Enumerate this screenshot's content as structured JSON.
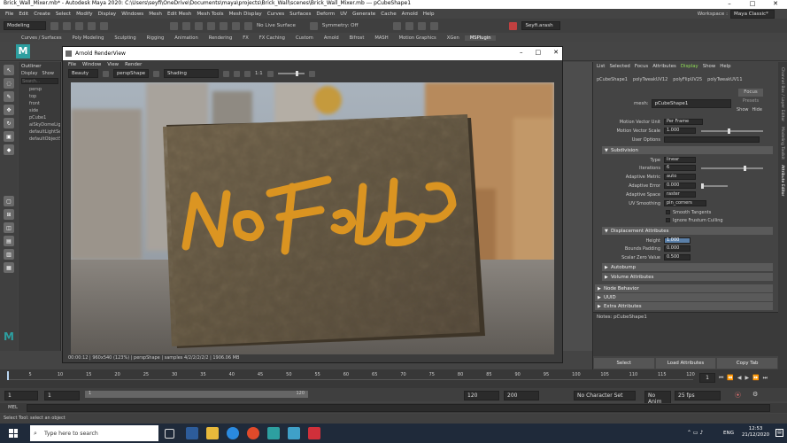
{
  "window_title": "Brick_Wall_Mixer.mb* - Autodesk Maya 2020: C:\\Users\\seyfi\\OneDrive\\Documents\\maya\\projects\\Brick_Wall\\scenes\\Brick_Wall_Mixer.mb --- pCubeShape1",
  "workspace_label": "Workspace :",
  "workspace_value": "Maya Classic*",
  "menus": [
    "File",
    "Edit",
    "Create",
    "Select",
    "Modify",
    "Display",
    "Windows",
    "Mesh",
    "Edit Mesh",
    "Mesh Tools",
    "Mesh Display",
    "Curves",
    "Surfaces",
    "Deform",
    "UV",
    "Generate",
    "Cache",
    "Arnold",
    "Help"
  ],
  "status": {
    "mode": "Modeling",
    "live_surface": "No Live Surface",
    "symmetry": "Symmetry: Off",
    "user": "Seyfi.arash"
  },
  "shelf_tabs": [
    "Curves / Surfaces",
    "Poly Modeling",
    "Sculpting",
    "Rigging",
    "Animation",
    "Rendering",
    "FX",
    "FX Caching",
    "Custom",
    "Arnold",
    "Bifrost",
    "MASH",
    "Motion Graphics",
    "XGen",
    "MSPlugin"
  ],
  "shelf_active": "MSPlugin",
  "outliner": {
    "title": "Outliner",
    "menu": [
      "Display",
      "Show"
    ],
    "search_placeholder": "Search...",
    "items": [
      "persp",
      "top",
      "front",
      "side",
      "pCube1",
      "aiSkyDomeLight1",
      "defaultLightSet",
      "defaultObjectSet"
    ]
  },
  "renderview": {
    "title": "Arnold RenderView",
    "menu": [
      "File",
      "Window",
      "View",
      "Render"
    ],
    "camera_dd": "Beauty",
    "view_dd": "perspShape",
    "shading_dd": "Shading",
    "ratio": "1:1",
    "status": "00:00:12 | 960x540 (123%) | perspShape | samples 4/2/2/2/2/2 | 1906.06 MB",
    "graffiti": "No Focus"
  },
  "viewport_label": "persp",
  "attr": {
    "menu": [
      "List",
      "Selected",
      "Focus",
      "Attributes",
      "Display",
      "Show",
      "Help"
    ],
    "tabs": [
      "pCubeShape1",
      "polyTweakUV12",
      "polyFlipUV25",
      "polyTweakUV11"
    ],
    "mesh_label": "mesh:",
    "mesh_value": "pCubeShape1",
    "focus_btn": "Focus",
    "presets_btn": "Presets",
    "show_btn": "Show",
    "hide_btn": "Hide",
    "rows": [
      {
        "label": "Motion Vector Unit",
        "value": "Per Frame"
      },
      {
        "label": "Motion Vector Scale",
        "value": "1.000"
      },
      {
        "label": "User Options",
        "value": ""
      }
    ],
    "subdiv_title": "Subdivision",
    "subdiv_rows": [
      {
        "label": "Type",
        "value": "linear"
      },
      {
        "label": "Iterations",
        "value": "6"
      },
      {
        "label": "Adaptive Metric",
        "value": "auto"
      },
      {
        "label": "Adaptive Error",
        "value": "0.000"
      },
      {
        "label": "Adaptive Space",
        "value": "raster"
      },
      {
        "label": "UV Smoothing",
        "value": "pin_corners"
      }
    ],
    "smooth_tangents": "Smooth Tangents",
    "ignore_frustum": "Ignore Frustum Culling",
    "disp_title": "Displacement Attributes",
    "disp_rows": [
      {
        "label": "Height",
        "value": "1.000"
      },
      {
        "label": "Bounds Padding",
        "value": "0.000"
      },
      {
        "label": "Scalar Zero Value",
        "value": "0.500"
      }
    ],
    "sections": [
      "Autobump",
      "Volume Attributes",
      "Node Behavior",
      "UUID",
      "Extra Attributes"
    ],
    "notes": "Notes: pCubeShape1",
    "buttons": [
      "Select",
      "Load Attributes",
      "Copy Tab"
    ]
  },
  "side_tabs": [
    "Channel Box / Layer Editor",
    "Modeling Toolkit",
    "Attribute Editor"
  ],
  "timeline": {
    "ticks": [
      "5",
      "10",
      "15",
      "20",
      "25",
      "30",
      "35",
      "40",
      "45",
      "50",
      "55",
      "60",
      "65",
      "70",
      "75",
      "80",
      "85",
      "90",
      "95",
      "100",
      "105",
      "110",
      "115",
      "120"
    ],
    "current": "1"
  },
  "range": {
    "start": "1",
    "start2": "1",
    "slider_start": "1",
    "slider_end": "120",
    "end": "120",
    "end2": "200",
    "character_set": "No Character Set",
    "anim_layer": "No Anim Layer",
    "fps": "25 fps"
  },
  "cmd_label": "MEL",
  "help_line": "Select Tool: select an object",
  "taskbar": {
    "search_placeholder": "Type here to search",
    "lang": "ENG",
    "time": "12:53",
    "date": "21/12/2020"
  }
}
